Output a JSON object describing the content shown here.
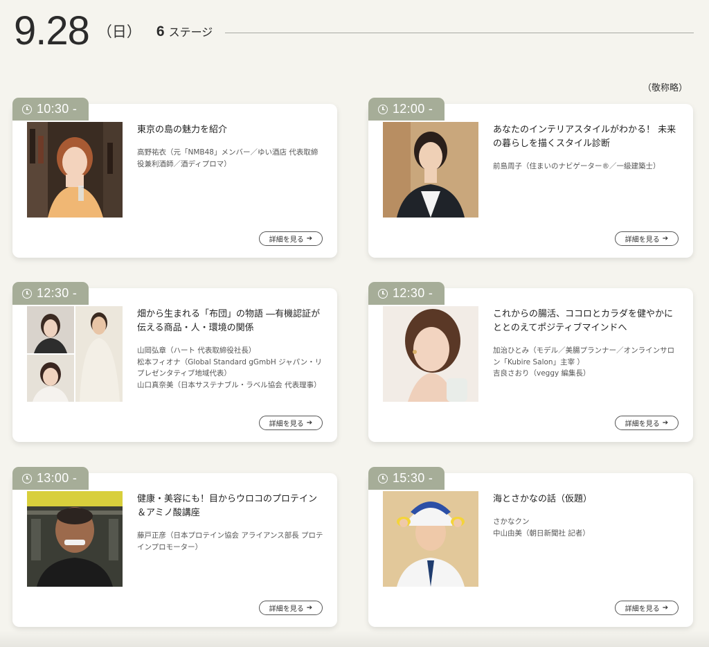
{
  "header": {
    "date": "9.28",
    "weekday": "（日）",
    "stage_count": "6",
    "stage_label": "ステージ"
  },
  "note": "（敬称略）",
  "colors": {
    "tab": "#a6ad98",
    "background": "#f5f4ee",
    "card": "#ffffff"
  },
  "cards": [
    {
      "time": "10:30 -",
      "title": "東京の島の魅力を紹介",
      "speakers": [
        "高野祐衣（元「NMB48」メンバー／ゆい酒店 代表取締役兼利酒師／酒ディプロマ）"
      ],
      "button": "詳細を見る",
      "icon": "arrow-right-icon"
    },
    {
      "time": "12:00 -",
      "title": "あなたのインテリアスタイルがわかる！ 未来の暮らしを描くスタイル診断",
      "speakers": [
        "前島周子（住まいのナビゲーター®／一級建築士）"
      ],
      "button": "詳細を見る",
      "icon": "arrow-right-icon"
    },
    {
      "time": "12:30 -",
      "title": "畑から生まれる「布団」の物語 ―有機認証が伝える商品・人・環境の関係",
      "speakers": [
        "山岡弘章（ハート 代表取締役社長）",
        "松本フィオナ（Global Standard gGmbH ジャパン・リプレゼンタティブ地域代表）",
        "山口真奈美（日本サステナブル・ラベル協会 代表理事）"
      ],
      "button": "詳細を見る",
      "icon": "arrow-right-icon"
    },
    {
      "time": "12:30 -",
      "title": "これからの腸活、ココロとカラダを健やかにととのえてポジティブマインドへ",
      "speakers": [
        "加治ひとみ（モデル／美腸プランナー／オンラインサロン「Kubire Salon」主宰 ）",
        "吉良さおり（veggy 編集長）"
      ],
      "button": "詳細を見る",
      "icon": "arrow-right-icon"
    },
    {
      "time": "13:00 -",
      "title": "健康・美容にも！目からウロコのプロテイン＆アミノ酸講座",
      "speakers": [
        "藤戸正彦（日本プロテイン協会 アライアンス部長 プロテインプロモーター）"
      ],
      "button": "詳細を見る",
      "icon": "arrow-right-icon"
    },
    {
      "time": "15:30 -",
      "title": "海とさかなの話（仮題）",
      "speakers": [
        "さかなクン",
        "中山由美（朝日新聞社 記者）"
      ],
      "button": "詳細を見る",
      "icon": "arrow-right-icon"
    }
  ]
}
